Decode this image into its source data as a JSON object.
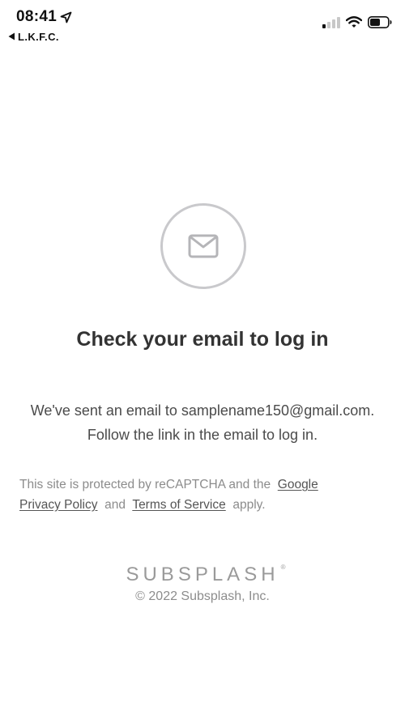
{
  "status_bar": {
    "time": "08:41",
    "back_label": "L.K.F.C."
  },
  "main": {
    "title": "Check your email to log in",
    "message_line1": "We've sent an email to samplename150@gmail.com.",
    "message_line2": "Follow the link in the email to log in."
  },
  "recaptcha": {
    "prefix": "This site is protected by reCAPTCHA and the",
    "google_link": "Google",
    "privacy_link": "Privacy Policy",
    "and": "and",
    "terms_link": "Terms of Service",
    "suffix": "apply."
  },
  "footer": {
    "logo": "SUBSPLASH",
    "logo_mark": "®",
    "copyright": "© 2022 Subsplash, Inc."
  },
  "colors": {
    "circle_border": "#c9c9cc",
    "icon": "#b5b5b8",
    "title": "#333333",
    "muted": "#8c8c8c"
  },
  "icons": [
    "location-arrow-icon",
    "back-triangle-icon",
    "signal-icon",
    "wifi-icon",
    "battery-icon",
    "envelope-icon"
  ]
}
